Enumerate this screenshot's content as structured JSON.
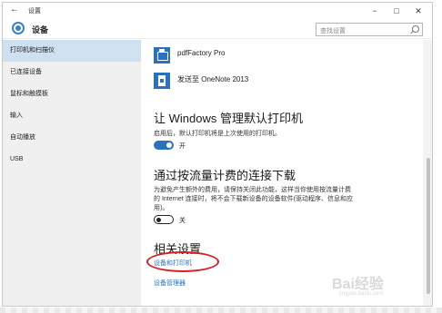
{
  "window": {
    "title": "设置",
    "back": "←",
    "minimize": "−",
    "maximize": "□",
    "close": "✕"
  },
  "header": {
    "title": "设备",
    "search_placeholder": "查找设置"
  },
  "sidebar": {
    "items": [
      {
        "label": "打印机和扫描仪",
        "active": true
      },
      {
        "label": "已连接设备",
        "active": false
      },
      {
        "label": "鼠标和触摸板",
        "active": false
      },
      {
        "label": "输入",
        "active": false
      },
      {
        "label": "自动播放",
        "active": false
      },
      {
        "label": "USB",
        "active": false
      }
    ]
  },
  "printers": [
    {
      "name": "pdfFactory Pro",
      "icon": "printer-icon"
    },
    {
      "name": "发送至 OneNote 2013",
      "icon": "document-icon"
    }
  ],
  "default_printer": {
    "title": "让 Windows 管理默认打印机",
    "description": "启用后，默认打印机将是上次使用的打印机。",
    "toggle_label": "开",
    "toggle_on": true
  },
  "metered": {
    "title": "通过按流量计费的连接下载",
    "description": "为避免产生额外的费用，请保持关闭此功能，这样当你使用按流量计费的 Internet 连接时，将不会下载新设备的设备软件(驱动程序、信息和应用)。",
    "toggle_label": "关",
    "toggle_on": false
  },
  "related": {
    "title": "相关设置",
    "links": [
      "设备和打印机",
      "设备管理器"
    ]
  },
  "watermark": {
    "brand": "Bai经验",
    "url": "jingyan.baidu.com"
  },
  "colors": {
    "accent": "#2b72be",
    "sidebar_bg": "#f0f0f0",
    "sidebar_active": "#cfe0f1",
    "highlight": "#d42020"
  }
}
